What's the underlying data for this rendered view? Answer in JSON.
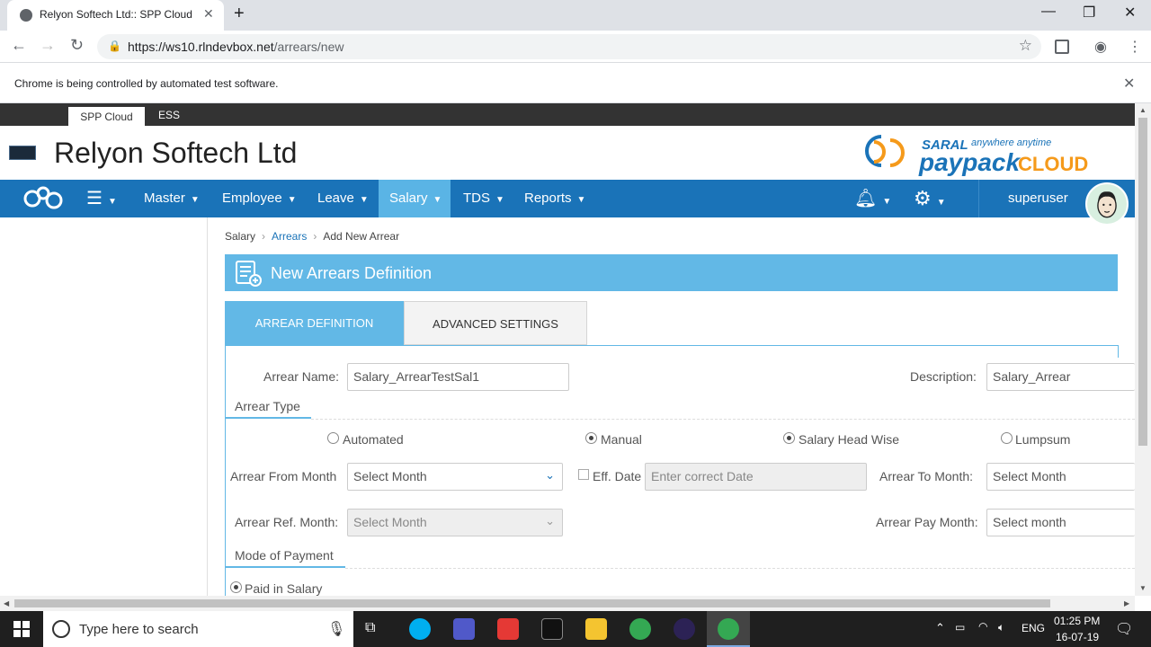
{
  "browser": {
    "tab_title": "Relyon Softech Ltd:: SPP Cloud",
    "url_host": "https://ws10.rlndevbox.net",
    "url_path": "/arrears/new",
    "infobar": "Chrome is being controlled by automated test software."
  },
  "app": {
    "tabs": [
      "SPP Cloud",
      "ESS"
    ],
    "company": "Relyon Softech Ltd",
    "brand": {
      "top": "SARAL",
      "tagline": "anywhere anytime",
      "pay": "paypack",
      "cloud": "CLOUD"
    },
    "nav": [
      "Master",
      "Employee",
      "Leave",
      "Salary",
      "TDS",
      "Reports"
    ],
    "active_nav": "Salary",
    "user": "superuser"
  },
  "breadcrumb": {
    "root": "Salary",
    "parent": "Arrears",
    "current": "Add New Arrear"
  },
  "panel": {
    "title": "New Arrears Definition"
  },
  "form_tabs": {
    "definition": "ARREAR DEFINITION",
    "advanced": "ADVANCED SETTINGS"
  },
  "form": {
    "arrear_name_label": "Arrear Name:",
    "arrear_name_value": "Salary_ArrearTestSal1",
    "description_label": "Description:",
    "description_value": "Salary_Arrear",
    "arrear_type_label": "Arrear Type",
    "types": [
      "Automated",
      "Manual",
      "Salary Head Wise",
      "Lumpsum"
    ],
    "from_month_label": "Arrear From Month",
    "from_month_placeholder": "Select Month",
    "eff_date_label": "Eff. Date",
    "eff_date_placeholder": "Enter correct Date",
    "to_month_label": "Arrear To Month:",
    "to_month_placeholder": "Select Month",
    "ref_month_label": "Arrear Ref. Month:",
    "ref_month_placeholder": "Select Month",
    "pay_month_label": "Arrear Pay Month:",
    "pay_month_placeholder": "Select month",
    "mode_label": "Mode of Payment",
    "mode_option": "Paid in Salary"
  },
  "taskbar": {
    "search": "Type here to search",
    "lang": "ENG",
    "time": "01:25 PM",
    "date": "16-07-19"
  },
  "colors": {
    "nav": "#1a73b8",
    "accent": "#62b8e6",
    "brand_orange": "#f59a1b"
  }
}
